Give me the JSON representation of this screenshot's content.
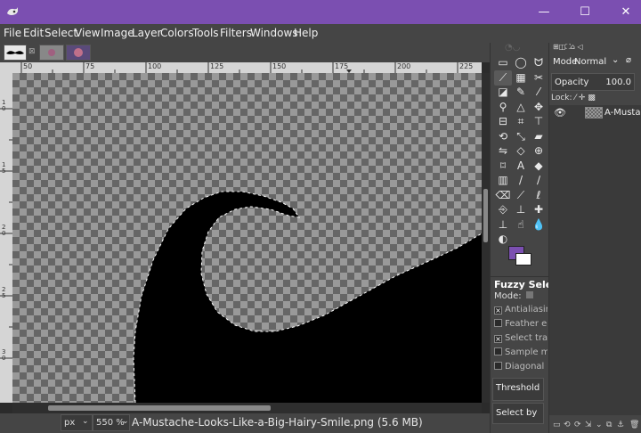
{
  "menu": [
    "File",
    "Edit",
    "Select",
    "View",
    "Image",
    "Layer",
    "Colors",
    "Tools",
    "Filters",
    "Windows",
    "Help"
  ],
  "window_controls": {
    "minimize": "—",
    "maximize": "☐",
    "close": "✕"
  },
  "ruler": {
    "h_ticks": [
      "50",
      "75",
      "100",
      "125",
      "150",
      "175",
      "200",
      "225"
    ],
    "v_ticks": [
      "1\n0",
      "1\n5",
      "2\n0",
      "2\n5",
      "3\n0"
    ]
  },
  "status": {
    "unit": "px",
    "zoom": "550 %",
    "filename": "A-Mustache-Looks-Like-a-Big-Hairy-Smile.png (5.6 MB)"
  },
  "tool_options": {
    "title": "Fuzzy Select",
    "mode_label": "Mode:",
    "antialiasing": "Antialiasing",
    "feather": "Feather edges",
    "select_transparent": "Select transparent",
    "sample_merged": "Sample merged",
    "diagonal": "Diagonal neighbors",
    "threshold": "Threshold",
    "select_by": "Select by"
  },
  "layers": {
    "mode_label": "Mode",
    "mode_value": "Normal",
    "opacity_label": "Opacity",
    "opacity_value": "100.0",
    "lock_label": "Lock:",
    "layer_name": "A-Mustache"
  },
  "colors": {
    "accent": "#7b4fb1",
    "foreground": "#7b4fb1",
    "background": "#ffffff"
  },
  "tools": [
    "rect-select",
    "ellipse-select",
    "free-select",
    "fuzzy-select",
    "color-select",
    "scissors",
    "foreground-select",
    "paths",
    "color-picker",
    "zoom",
    "measure",
    "move",
    "align",
    "crop",
    "unified-transform",
    "rotate",
    "scale",
    "shear",
    "flip",
    "perspective",
    "warp",
    "cage",
    "text",
    "bucket-fill",
    "gradient",
    "pencil",
    "paintbrush",
    "eraser",
    "airbrush",
    "ink",
    "mypaint-brush",
    "clone",
    "heal",
    "perspective-clone",
    "smudge",
    "blur",
    "dodge-burn"
  ]
}
